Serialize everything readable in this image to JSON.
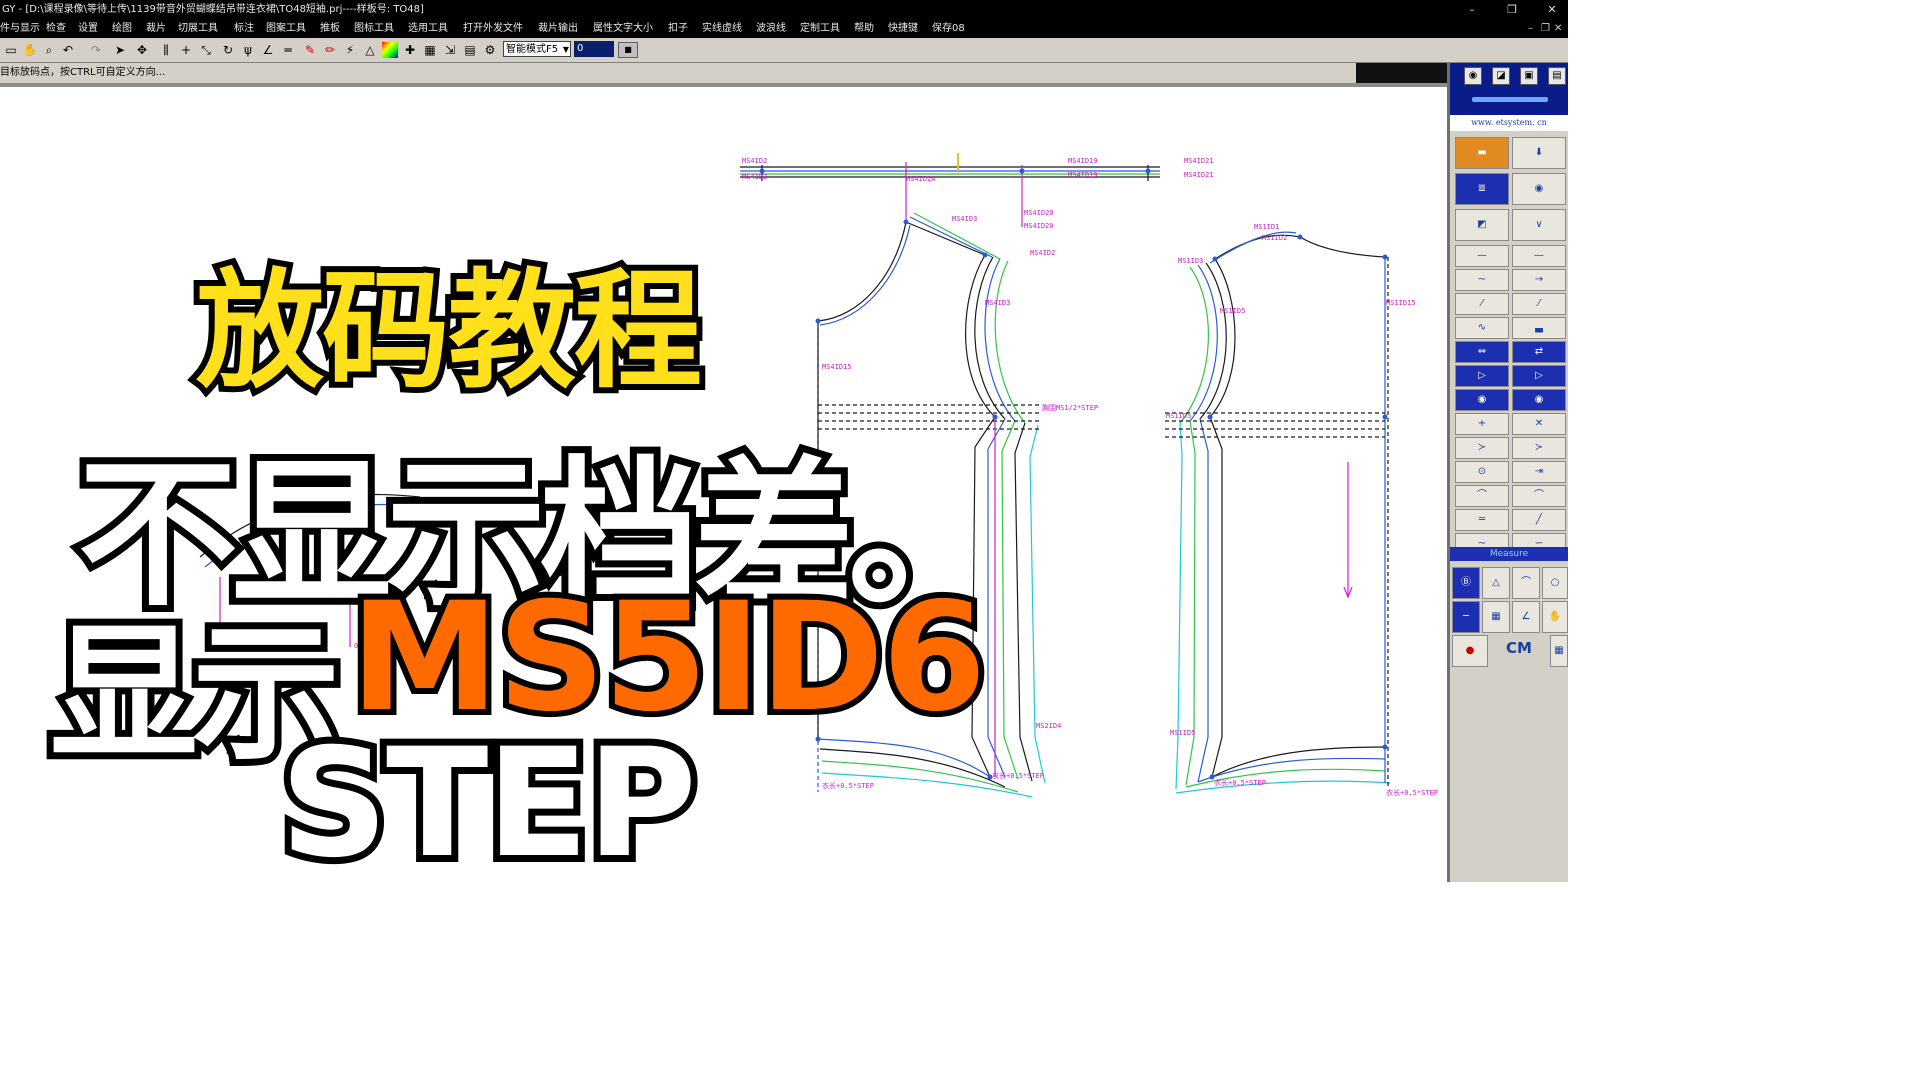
{
  "window": {
    "title": "GY - [D:\\课程录像\\等待上传\\1139带音外贸蝴蝶结吊带连衣裙\\TO48短袖.prj----样板号: TO48]",
    "min_glyph": "–",
    "max_glyph": "❐",
    "close_glyph": "✕",
    "sub_min_glyph": "–",
    "sub_max_glyph": "❐",
    "sub_close_glyph": "✕"
  },
  "menu": [
    "文件与显示",
    "检查",
    "设置",
    "绘图",
    "裁片",
    "切展工具",
    "标注",
    "图案工具",
    "推板",
    "图标工具",
    "选用工具",
    "打开外发文件",
    "裁片输出",
    "属性文字大小",
    "扣子",
    "实线虚线",
    "波浪线",
    "定制工具",
    "帮助",
    "快捷键",
    "保存08"
  ],
  "toolbar": {
    "mode_label": "智能模式F5",
    "number_value": "0",
    "ok_label": "■"
  },
  "status": {
    "hint": "目标放码点，按CTRL可自定义方向..."
  },
  "overlay": {
    "line1": "放码教程",
    "line2": "不显示档差。",
    "line3_prefix": "显示",
    "line3_code": "MS5ID6",
    "line4": "STEP"
  },
  "pattern_labels": {
    "top_left_a": "MS4ID2",
    "top_left_b": "MS4ID2",
    "top_mid": "MS4ID2A",
    "top_right_a": "MS4ID19",
    "top_right_b": "MS4ID19",
    "top_far_a": "MS4ID21",
    "top_far_b": "MS4ID21",
    "mid_a": "MS4ID20",
    "mid_b": "MS4ID20",
    "front_neck": "MS4ID3",
    "front_shoulder": "MS4ID2",
    "front_armhole": "MS4ID3",
    "front_side": "MS4ID15",
    "front_bust": "胸围MS1/2*STEP",
    "front_hem_mid": "MS2ID4",
    "front_hem_left": "衣长+0.5*STEP",
    "front_hem_right": "衣长+0.5*STEP",
    "back_neck_a": "MS1ID1",
    "back_neck_b": "MS1ID2",
    "back_shoulder": "MS1ID3",
    "back_armhole": "MS1ID5",
    "back_right": "MS1ID15",
    "back_bust": "MS1ID5",
    "back_hem_left": "MS1ID5",
    "back_hem_mid": "衣长+0.5*STEP",
    "back_hem_right": "衣长+0.5*STEP",
    "left_small_a": "0.5",
    "left_small_b": "0.5"
  },
  "right_panel": {
    "url": "www. etsystem. cn",
    "measure_label": "Measure",
    "unit": "CM"
  },
  "colors": {
    "line_black": "#1a1a1a",
    "line_blue": "#2a5bd7",
    "line_green": "#33c24a",
    "line_cyan": "#1ec8d8",
    "line_magenta": "#d020d0",
    "overlay_yellow": "#ffe01a",
    "overlay_orange": "#ff6a00"
  },
  "icons": [
    "new-icon",
    "hand-icon",
    "zoom-icon",
    "undo-icon",
    "redo-icon",
    "select-icon",
    "move-icon",
    "align-icon",
    "cross-icon",
    "scale-icon",
    "rotate-icon",
    "fork-icon",
    "angle-icon",
    "parallel-icon",
    "pen-icon",
    "grade-icon",
    "palette-icon",
    "arrow-icon",
    "grid-icon",
    "table-icon",
    "setting-icon"
  ]
}
